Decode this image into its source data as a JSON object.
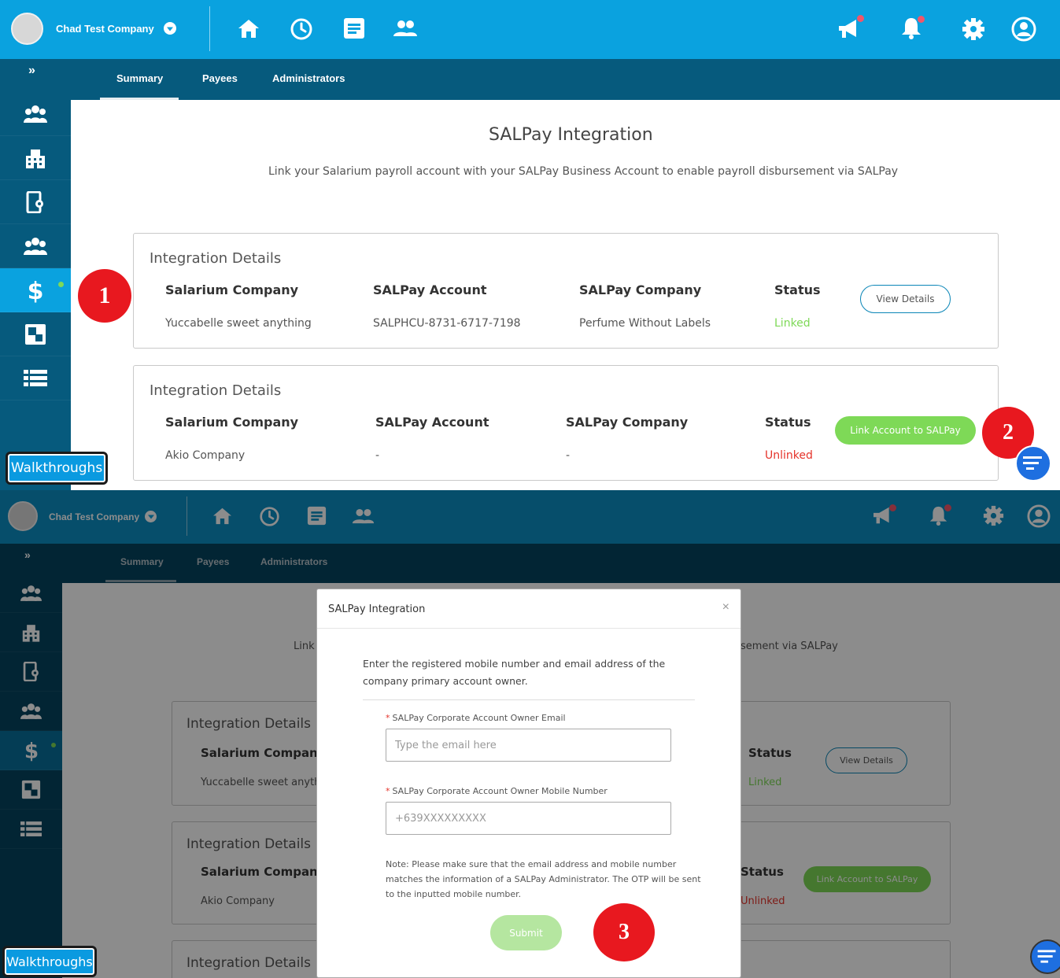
{
  "colors": {
    "topbar": "#0aa2df",
    "sidebar": "#065a7d",
    "linked": "#7ed957",
    "unlinked": "#e5332a",
    "marker": "#e8181f"
  },
  "header": {
    "company_name": "Chad Test Company",
    "icons": [
      "home-icon",
      "clock-icon",
      "document-icon",
      "people-icon",
      "megaphone-icon",
      "bell-icon",
      "gear-icon",
      "user-icon"
    ]
  },
  "tabs": [
    "Summary",
    "Payees",
    "Administrators"
  ],
  "sidebar": {
    "expand_label": "»",
    "items": [
      "team-icon",
      "building-icon",
      "device-settings-icon",
      "group-icon",
      "dollar-icon",
      "squares-icon",
      "list-icon"
    ]
  },
  "page": {
    "title": "SALPay Integration",
    "description": "Link your Salarium payroll account with your SALPay Business Account to enable payroll disbursement via SALPay",
    "description_left_bot": "Link",
    "description_right_bot": "sement via SALPay"
  },
  "columns": [
    "Salarium Company",
    "SALPay Account",
    "SALPay Company",
    "Status"
  ],
  "cards": [
    {
      "title": "Integration Details",
      "salarium_company": "Yuccabelle sweet anything",
      "salarium_company_truncated": "Yuccabelle sweet anythi",
      "salpay_account": "SALPHCU-8731-6717-7198",
      "salpay_company": "Perfume Without Labels",
      "status": "Linked",
      "action": "View Details"
    },
    {
      "title": "Integration Details",
      "salarium_company": "Akio Company",
      "salpay_account": "-",
      "salpay_company": "-",
      "status": "Unlinked",
      "action": "Link Account to SALPay"
    },
    {
      "title": "Integration Details"
    }
  ],
  "markers": [
    "1",
    "2",
    "3"
  ],
  "walkthroughs": "Walkthroughs",
  "modal": {
    "title": "SALPay Integration",
    "close": "×",
    "intro": "Enter the registered mobile number and email address of the company primary account owner.",
    "email_label": "SALPay Corporate Account Owner Email",
    "email_placeholder": "Type the email here",
    "mobile_label": "SALPay Corporate Account Owner Mobile Number",
    "mobile_placeholder": "+639XXXXXXXXX",
    "required_mark": "*",
    "note": "Note: Please make sure that the email address and mobile number matches the information of a SALPay Administrator. The OTP will be sent to the inputted mobile number.",
    "submit": "Submit"
  }
}
